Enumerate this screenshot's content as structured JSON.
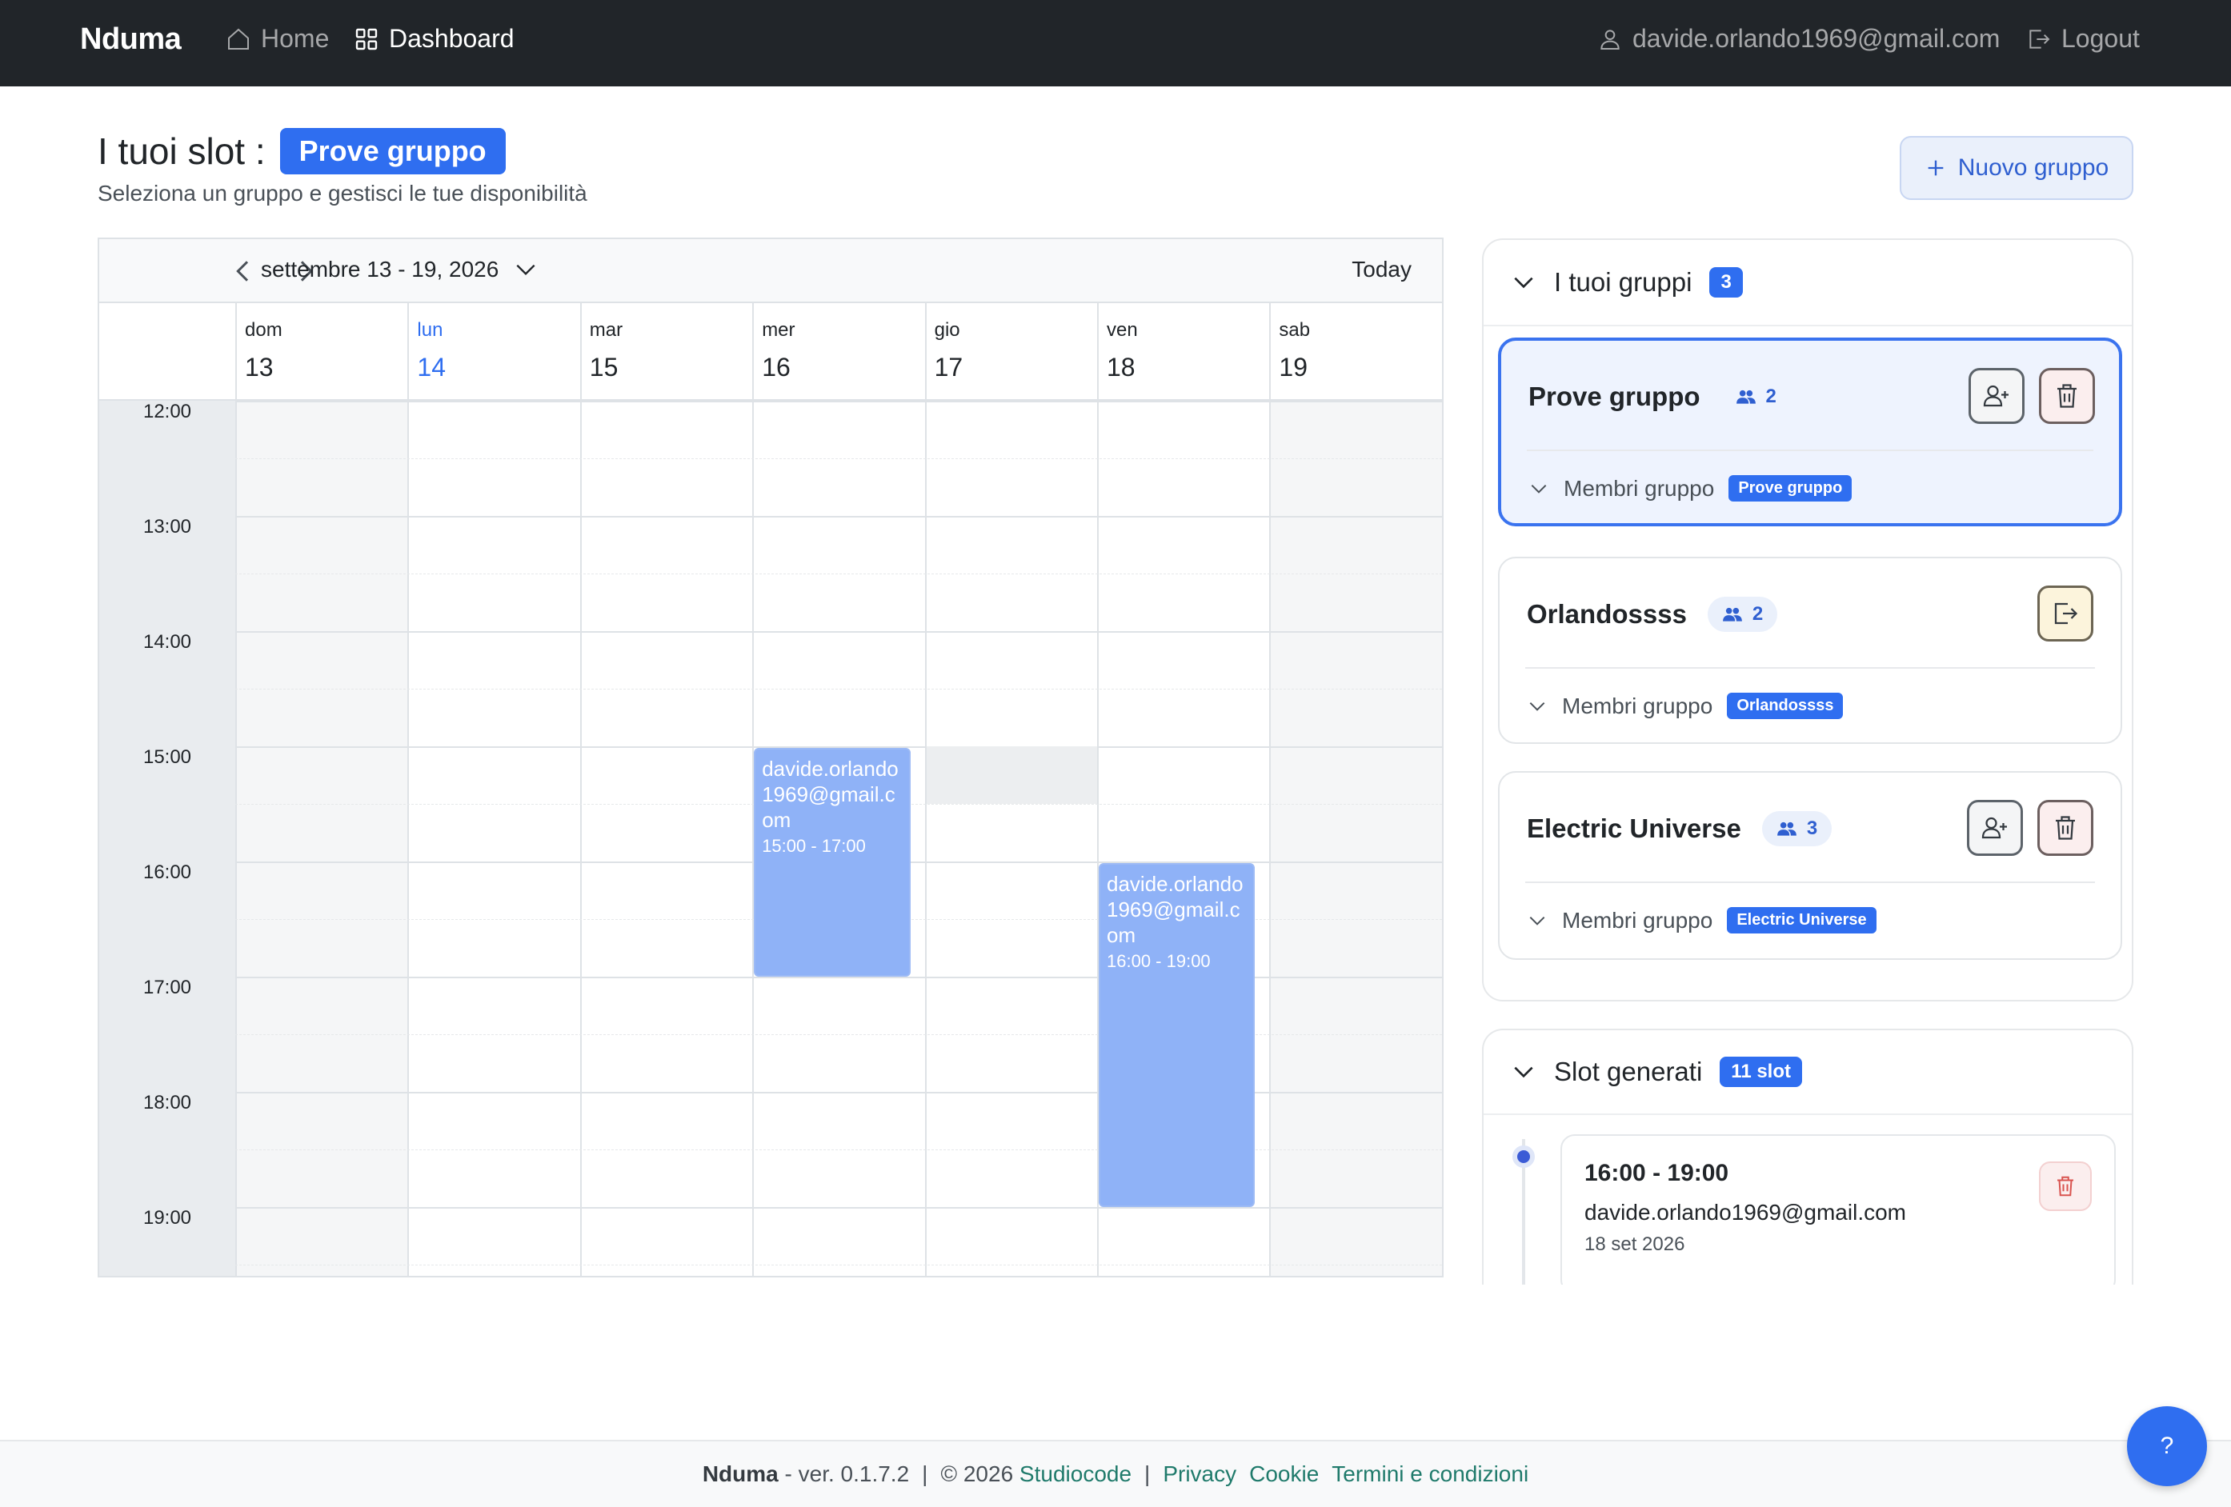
{
  "navbar": {
    "brand": "Nduma",
    "home": "Home",
    "dashboard": "Dashboard",
    "user_email": "davide.orlando1969@gmail.com",
    "logout": "Logout"
  },
  "header": {
    "title": "I tuoi slot :",
    "selected_group": "Prove gruppo",
    "subtitle": "Seleziona un gruppo e gestisci le tue disponibilità",
    "new_group_button": "Nuovo gruppo"
  },
  "calendar": {
    "range_label": "settembre 13 - 19, 2026",
    "today_button": "Today",
    "days": [
      {
        "name": "dom",
        "num": "13"
      },
      {
        "name": "lun",
        "num": "14"
      },
      {
        "name": "mar",
        "num": "15"
      },
      {
        "name": "mer",
        "num": "16"
      },
      {
        "name": "gio",
        "num": "17"
      },
      {
        "name": "ven",
        "num": "18"
      },
      {
        "name": "sab",
        "num": "19"
      }
    ],
    "hours": [
      "12:00",
      "13:00",
      "14:00",
      "15:00",
      "16:00",
      "17:00",
      "18:00",
      "19:00"
    ],
    "events": [
      {
        "title": "davide.orlando1969@gmail.com",
        "time": "15:00 - 17:00"
      },
      {
        "title": "davide.orlando1969@gmail.com",
        "time": "16:00 - 19:00"
      }
    ]
  },
  "groups_panel": {
    "title": "I tuoi gruppi",
    "count": "3",
    "members_label": "Membri gruppo",
    "groups": [
      {
        "name": "Prove gruppo",
        "members": "2",
        "tag": "Prove gruppo"
      },
      {
        "name": "Orlandossss",
        "members": "2",
        "tag": "Orlandossss"
      },
      {
        "name": "Electric Universe",
        "members": "3",
        "tag": "Electric Universe"
      }
    ]
  },
  "slots_panel": {
    "title": "Slot generati",
    "count": "11 slot",
    "items": [
      {
        "time": "16:00 - 19:00",
        "email": "davide.orlando1969@gmail.com",
        "date": "18 set 2026"
      }
    ]
  },
  "footer": {
    "brand": "Nduma",
    "version": "- ver. 0.1.7.2",
    "sep1": "|",
    "copyright": "© 2026",
    "company": "Studiocode",
    "sep2": "|",
    "privacy": "Privacy",
    "cookie": "Cookie",
    "terms": "Termini e condizioni"
  },
  "help_button": "?",
  "colors": {
    "navbar": "#212529",
    "accent": "#2f6ef0",
    "event": "#8fb2f7"
  }
}
